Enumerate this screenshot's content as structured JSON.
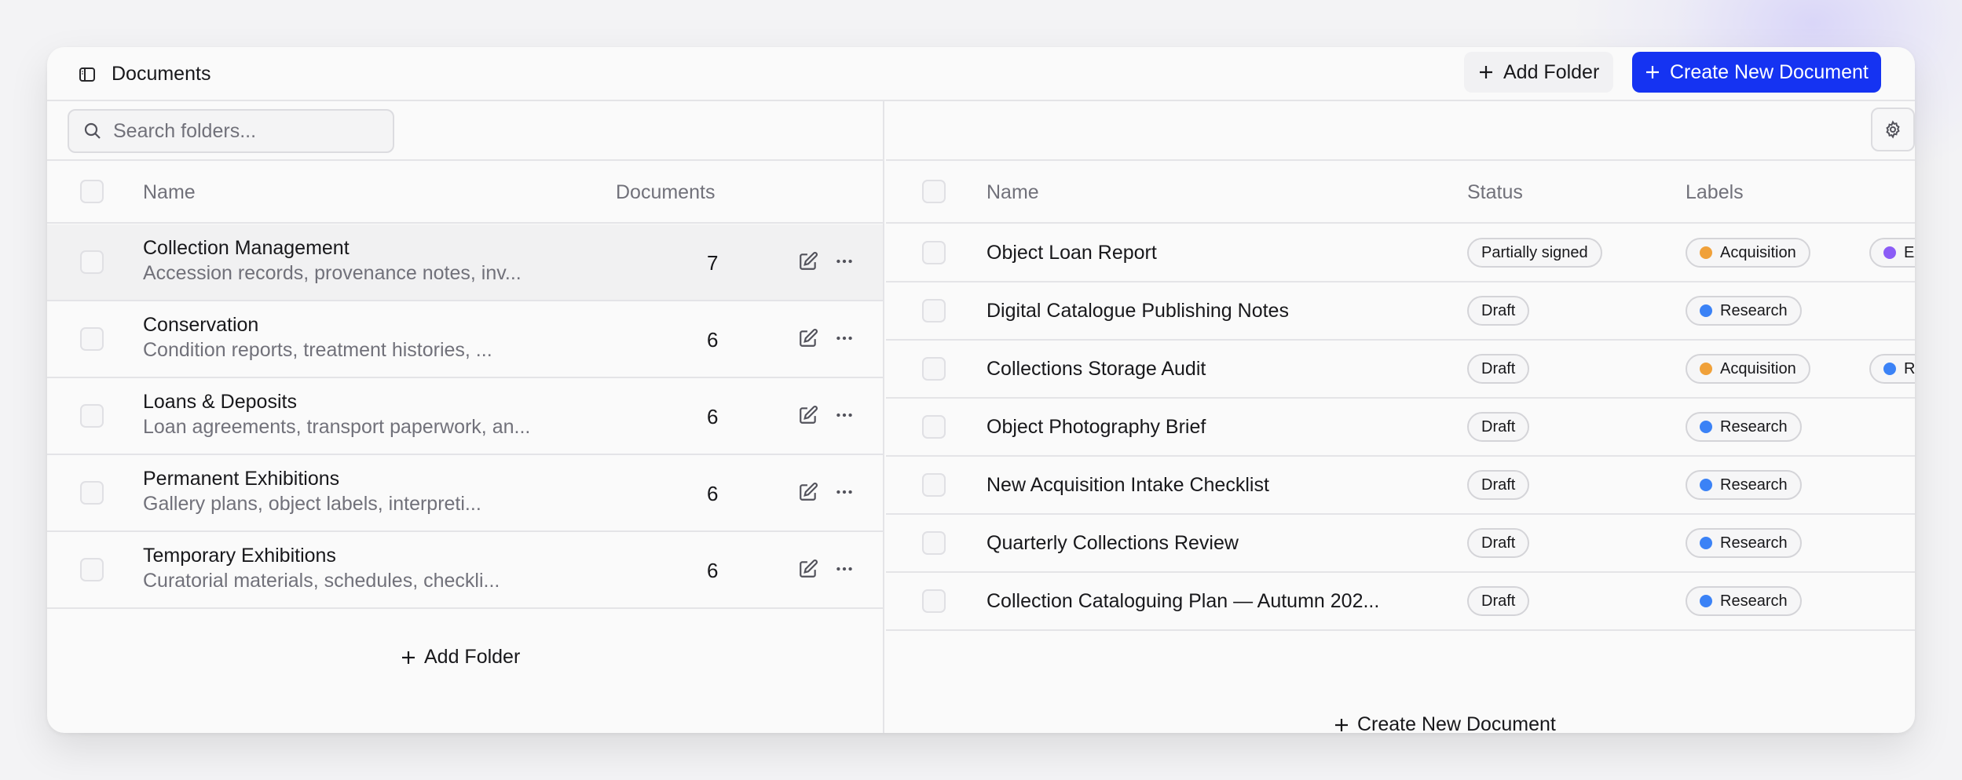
{
  "app": {
    "title": "Documents"
  },
  "header": {
    "add_folder_label": "Add Folder",
    "create_document_label": "Create New Document"
  },
  "folders": {
    "search_placeholder": "Search folders...",
    "columns": {
      "name": "Name",
      "documents": "Documents"
    },
    "rows": [
      {
        "name": "Collection Management",
        "desc": "Accession records, provenance notes, inv...",
        "count": "7"
      },
      {
        "name": "Conservation",
        "desc": "Condition reports, treatment histories, ...",
        "count": "6"
      },
      {
        "name": "Loans & Deposits",
        "desc": "Loan agreements, transport paperwork, an...",
        "count": "6"
      },
      {
        "name": "Permanent Exhibitions",
        "desc": "Gallery plans, object labels, interpreti...",
        "count": "6"
      },
      {
        "name": "Temporary Exhibitions",
        "desc": "Curatorial materials, schedules, checkli...",
        "count": "6"
      }
    ],
    "add_folder_label": "Add Folder"
  },
  "documents": {
    "columns": {
      "name": "Name",
      "status": "Status",
      "labels": "Labels"
    },
    "rows": [
      {
        "name": "Object Loan Report",
        "status": "Partially signed",
        "labels": [
          {
            "text": "Acquisition",
            "color": "#f0a13a"
          },
          {
            "text": "Exhibitions",
            "color": "#8b5cf6"
          }
        ]
      },
      {
        "name": "Digital Catalogue Publishing Notes",
        "status": "Draft",
        "labels": [
          {
            "text": "Research",
            "color": "#3b82f6"
          }
        ]
      },
      {
        "name": "Collections Storage Audit",
        "status": "Draft",
        "labels": [
          {
            "text": "Acquisition",
            "color": "#f0a13a"
          },
          {
            "text": "Research",
            "color": "#3b82f6"
          }
        ]
      },
      {
        "name": "Object Photography Brief",
        "status": "Draft",
        "labels": [
          {
            "text": "Research",
            "color": "#3b82f6"
          }
        ]
      },
      {
        "name": "New Acquisition Intake Checklist",
        "status": "Draft",
        "labels": [
          {
            "text": "Research",
            "color": "#3b82f6"
          }
        ]
      },
      {
        "name": "Quarterly Collections Review",
        "status": "Draft",
        "labels": [
          {
            "text": "Research",
            "color": "#3b82f6"
          }
        ]
      },
      {
        "name": "Collection Cataloguing Plan — Autumn 202...",
        "status": "Draft",
        "labels": [
          {
            "text": "Research",
            "color": "#3b82f6"
          }
        ]
      }
    ],
    "create_document_label": "Create New Document"
  },
  "colors": {
    "primary": "#1533f2",
    "border": "#e4e4e7",
    "muted_text": "#71717a"
  }
}
